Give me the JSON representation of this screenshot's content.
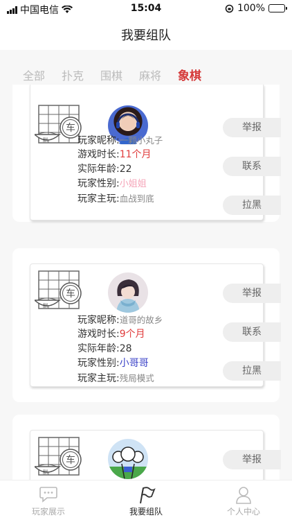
{
  "status_bar": {
    "carrier": "中国电信",
    "time": "15:04",
    "battery": "100%"
  },
  "header": {
    "title": "我要组队"
  },
  "tabs": [
    {
      "label": "全部",
      "active": false
    },
    {
      "label": "扑克",
      "active": false
    },
    {
      "label": "围棋",
      "active": false
    },
    {
      "label": "麻将",
      "active": false
    },
    {
      "label": "象棋",
      "active": true
    }
  ],
  "labels": {
    "nickname": "玩家昵称:",
    "duration": "游戏时长:",
    "age": "实际年龄:",
    "gender": "玩家性别:",
    "main": "玩家主玩:",
    "report": "举报",
    "contact": "联系",
    "block": "拉黑"
  },
  "cards": [
    {
      "nickname": "一颗小丸子",
      "duration": "11个月",
      "age": "22",
      "gender": "小姐姐",
      "main": "血战到底"
    },
    {
      "nickname": "道哥的故乡",
      "duration": "9个月",
      "age": "28",
      "gender": "小哥哥",
      "main": "残局模式"
    },
    {
      "nickname": "",
      "duration": "",
      "age": "",
      "gender": "",
      "main": ""
    }
  ],
  "board_icon_text": "车",
  "bottom_nav": [
    {
      "label": "玩家展示",
      "icon": "chat-bubble-icon",
      "active": false
    },
    {
      "label": "我要组队",
      "icon": "flag-icon",
      "active": true
    },
    {
      "label": "个人中心",
      "icon": "person-icon",
      "active": false
    }
  ]
}
